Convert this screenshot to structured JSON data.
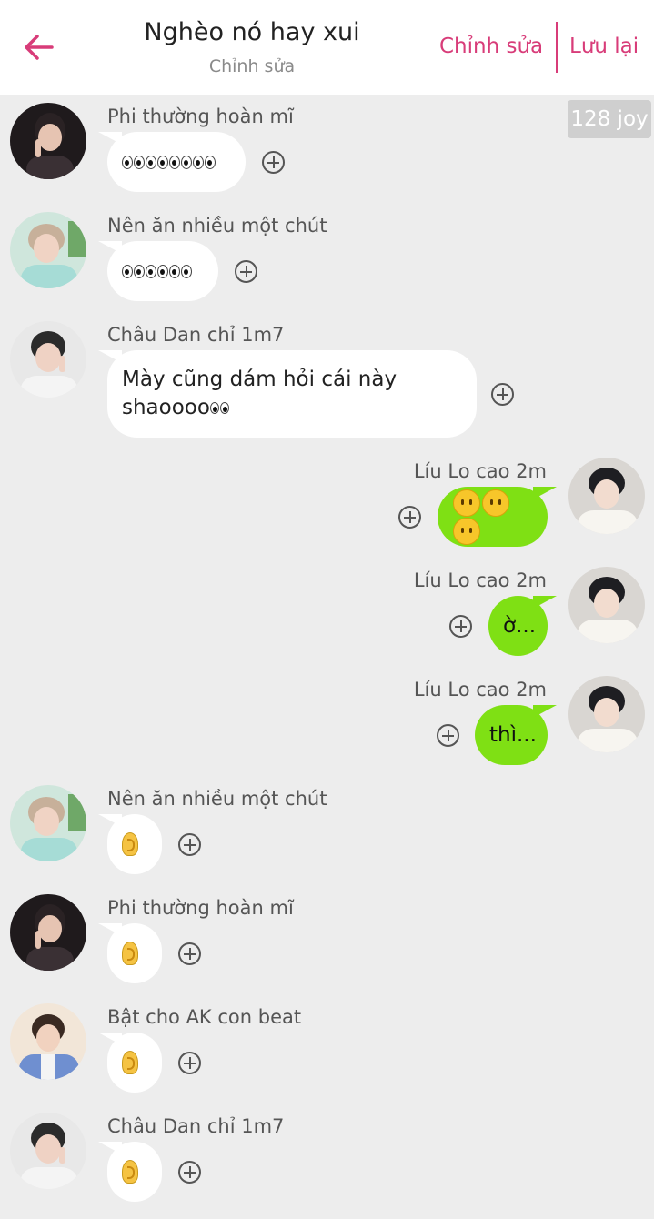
{
  "header": {
    "title": "Nghèo nó hay xui",
    "subtitle": "Chỉnh sửa",
    "edit_label": "Chỉnh sửa",
    "save_label": "Lưu lại",
    "back_icon": "arrow-left-icon",
    "accent_color": "#d83c79"
  },
  "joy_badge": "128 joy",
  "colors": {
    "background": "#ededed",
    "outgoing_bubble": "#7fe014",
    "incoming_bubble": "#ffffff"
  },
  "messages": [
    {
      "side": "left",
      "sender": "Phi thường hoàn mĩ",
      "content_type": "emoji",
      "emoji": "eyes",
      "emoji_count": 8
    },
    {
      "side": "left",
      "sender": "Nên ăn nhiều một chút",
      "content_type": "emoji",
      "emoji": "eyes",
      "emoji_count": 6
    },
    {
      "side": "left",
      "sender": "Châu Dan chỉ 1m7",
      "content_type": "text",
      "text": "Mày cũng dám hỏi cái này",
      "text_line2": "shaoooo",
      "trailing_emoji": "eyes"
    },
    {
      "side": "right",
      "sender": "Líu Lo cao 2m",
      "content_type": "emoji",
      "emoji": "neutral-face",
      "emoji_count": 3
    },
    {
      "side": "right",
      "sender": "Líu Lo cao 2m",
      "content_type": "text",
      "text": "ờ..."
    },
    {
      "side": "right",
      "sender": "Líu Lo cao 2m",
      "content_type": "text",
      "text": "thì..."
    },
    {
      "side": "left",
      "sender": "Nên ăn nhiều một chút",
      "content_type": "emoji",
      "emoji": "ear",
      "emoji_count": 1
    },
    {
      "side": "left",
      "sender": "Phi thường hoàn mĩ",
      "content_type": "emoji",
      "emoji": "ear",
      "emoji_count": 1
    },
    {
      "side": "left",
      "sender": "Bật cho AK con beat",
      "content_type": "emoji",
      "emoji": "ear",
      "emoji_count": 1
    },
    {
      "side": "left",
      "sender": "Châu Dan chỉ 1m7",
      "content_type": "emoji",
      "emoji": "ear",
      "emoji_count": 1
    }
  ]
}
